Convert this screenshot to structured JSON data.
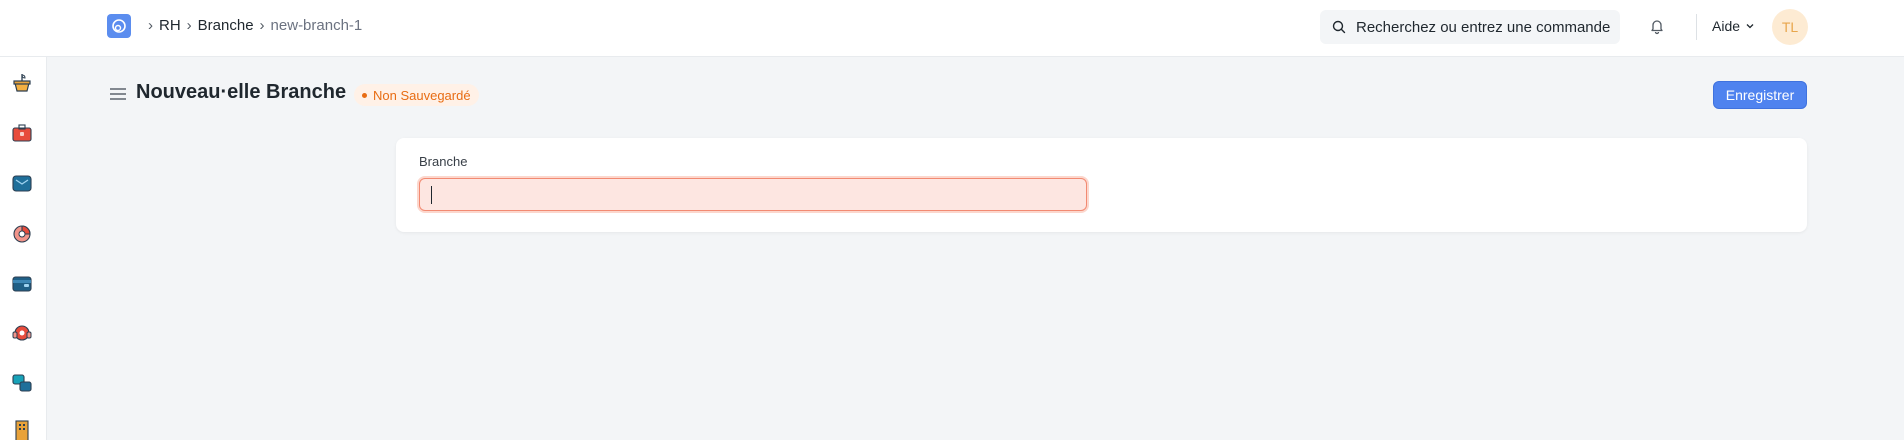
{
  "navbar": {
    "logo_icon": "app-logo-icon",
    "breadcrumbs": [
      "RH",
      "Branche",
      "new-branch-1"
    ],
    "search_placeholder": "Recherchez ou entrez une commande",
    "help_label": "Aide",
    "avatar_initials": "TL"
  },
  "sidebar": {
    "icons": [
      "plant-pot-icon",
      "toolbox-icon",
      "mail-icon",
      "pie-chart-icon",
      "wallet-icon",
      "headset-icon",
      "stack-icon",
      "building-icon"
    ]
  },
  "page": {
    "title": "Nouveau·elle Branche",
    "status": "Non Sauvegardé",
    "save_label": "Enregistrer"
  },
  "form": {
    "field_label": "Branche",
    "field_value": ""
  },
  "colors": {
    "accent": "#4f83ef",
    "warning": "#e86c13",
    "invalid_field_bg": "#fde6e1"
  }
}
